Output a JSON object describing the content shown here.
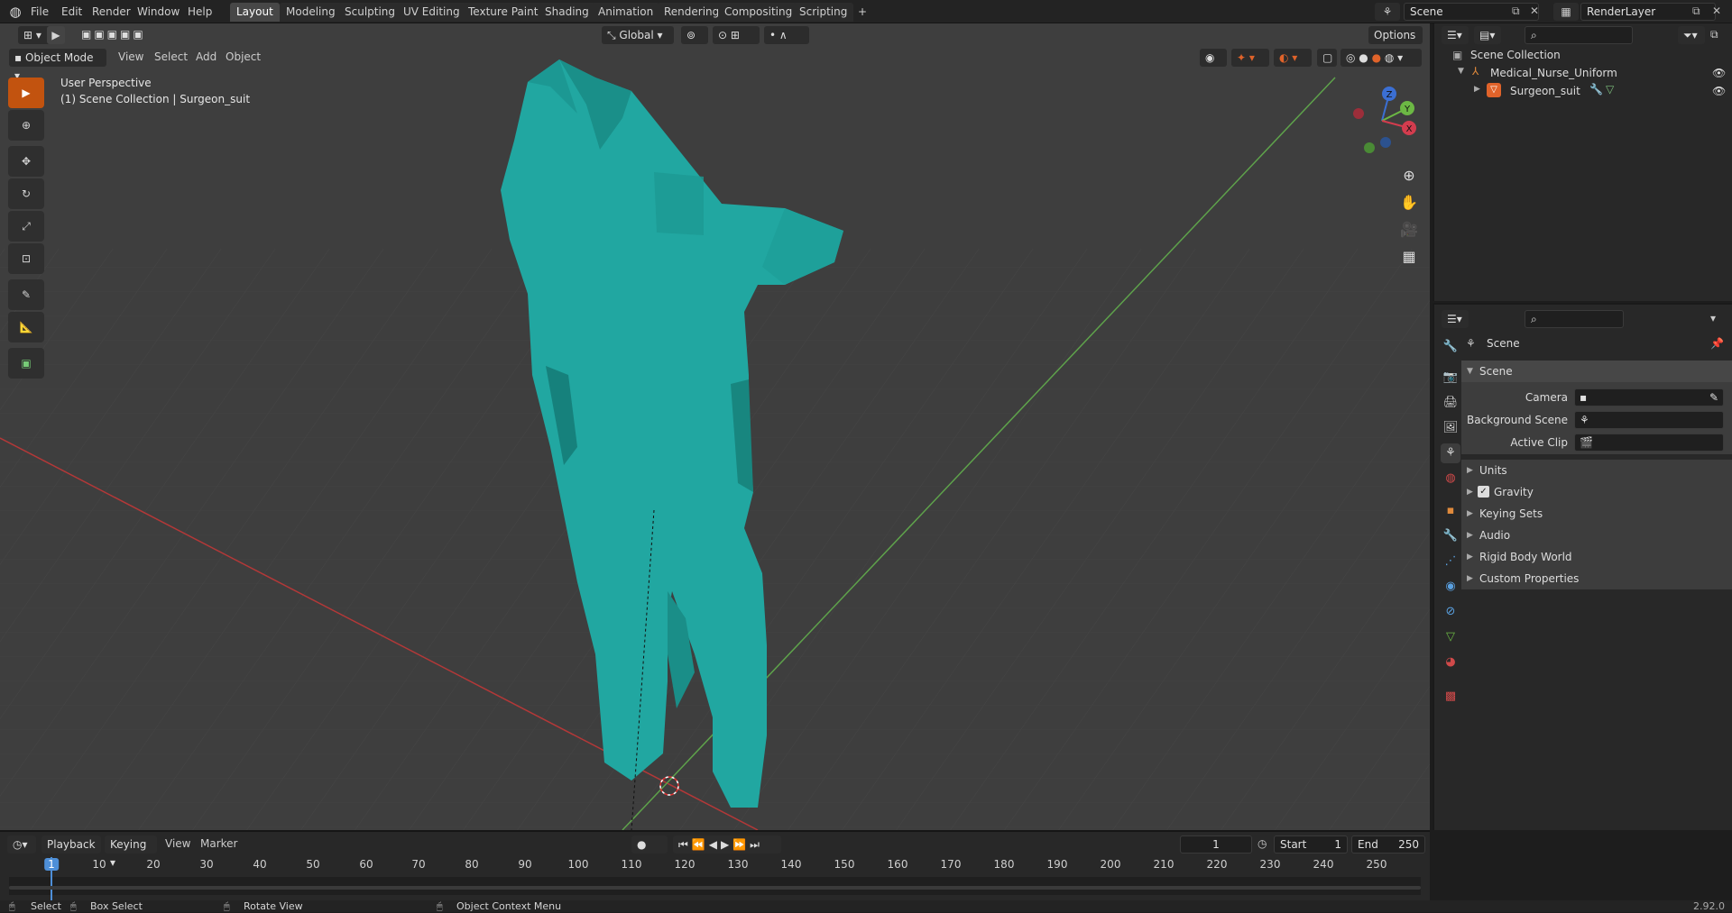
{
  "menu": {
    "file": "File",
    "edit": "Edit",
    "render": "Render",
    "window": "Window",
    "help": "Help"
  },
  "workspaces": [
    "Layout",
    "Modeling",
    "Sculpting",
    "UV Editing",
    "Texture Paint",
    "Shading",
    "Animation",
    "Rendering",
    "Compositing",
    "Scripting"
  ],
  "add_workspace": "+",
  "scene_name": "Scene",
  "render_layer": "RenderLayer",
  "header": {
    "transform_orientation": "Global",
    "options": "Options",
    "mode": "Object Mode",
    "view": "View",
    "select": "Select",
    "add": "Add",
    "object": "Object"
  },
  "viewport": {
    "perspective": "User Perspective",
    "collection_path": "(1) Scene Collection | Surgeon_suit",
    "mesh_color": "#21a7a1"
  },
  "gizmo": {
    "x": "X",
    "y": "Y",
    "z": "Z"
  },
  "outliner": {
    "root": "Scene Collection",
    "collection": "Medical_Nurse_Uniform",
    "object": "Surgeon_suit"
  },
  "properties": {
    "context": "Scene",
    "section": "Scene",
    "camera_label": "Camera",
    "background_scene_label": "Background Scene",
    "active_clip_label": "Active Clip",
    "units": "Units",
    "gravity": "Gravity",
    "gravity_checked": true,
    "keying_sets": "Keying Sets",
    "audio": "Audio",
    "rigid_body_world": "Rigid Body World",
    "custom_properties": "Custom Properties"
  },
  "timeline": {
    "playback": "Playback",
    "keying": "Keying",
    "view": "View",
    "marker": "Marker",
    "current_frame": "1",
    "start_label": "Start",
    "start": "1",
    "end_label": "End",
    "end": "250",
    "ruler": [
      "1",
      "10",
      "20",
      "30",
      "40",
      "50",
      "60",
      "70",
      "80",
      "90",
      "100",
      "110",
      "120",
      "130",
      "140",
      "150",
      "160",
      "170",
      "180",
      "190",
      "200",
      "210",
      "220",
      "230",
      "240",
      "250"
    ]
  },
  "status": {
    "select": "Select",
    "box_select": "Box Select",
    "rotate_view": "Rotate View",
    "context_menu": "Object Context Menu",
    "version": "2.92.0"
  }
}
